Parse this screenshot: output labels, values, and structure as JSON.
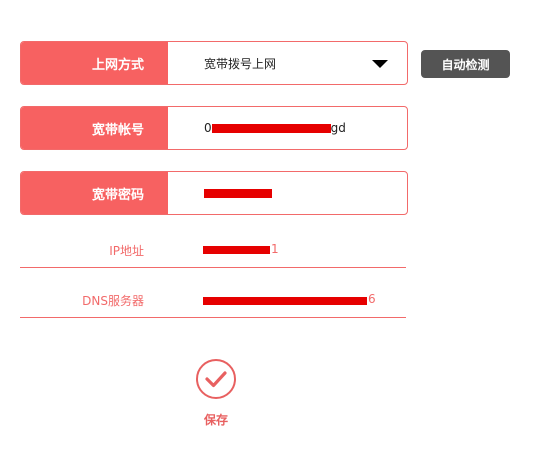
{
  "connection": {
    "label": "上网方式",
    "value": "宽带拨号上网",
    "detect_button": "自动检测"
  },
  "account": {
    "label": "宽带帐号",
    "visible_start": "0",
    "visible_end": "gd"
  },
  "password": {
    "label": "宽带密码"
  },
  "ip": {
    "label": "IP地址",
    "visible_tail": "1"
  },
  "dns": {
    "label": "DNS服务器",
    "visible_tail": "6"
  },
  "save": {
    "label": "保存"
  },
  "colors": {
    "accent": "#f76161",
    "detect_button": "#545454",
    "redaction": "#e60000"
  },
  "icons": {
    "dropdown": "caret-down-icon",
    "save": "check-circle-icon"
  }
}
